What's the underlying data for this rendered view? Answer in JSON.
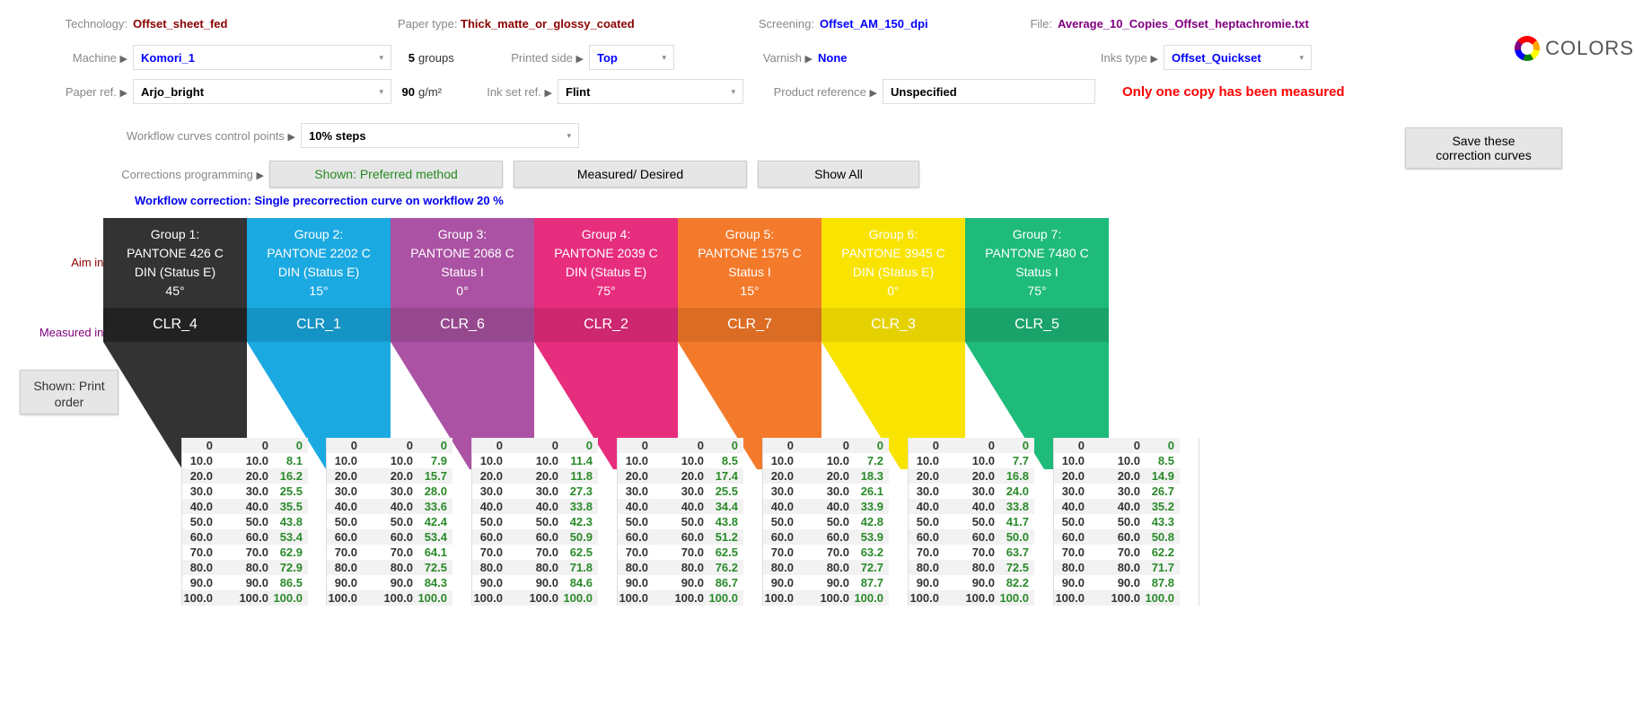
{
  "header": {
    "technology_label": "Technology:",
    "technology": "Offset_sheet_fed",
    "paper_type_label": "Paper type:",
    "paper_type": "Thick_matte_or_glossy_coated",
    "screening_label": "Screening:",
    "screening": "Offset_AM_150_dpi",
    "file_label": "File:",
    "file": "Average_10_Copies_Offset_heptachromie.txt",
    "machine_label": "Machine",
    "machine": "Komori_1",
    "groups_count": "5",
    "groups_unit": "groups",
    "printed_side_label": "Printed side",
    "printed_side": "Top",
    "varnish_label": "Varnish",
    "varnish": "None",
    "inks_type_label": "Inks type",
    "inks_type": "Offset_Quickset",
    "paper_ref_label": "Paper ref.",
    "paper_ref": "Arjo_bright",
    "gm": "90",
    "gm_unit": "g/m²",
    "ink_set_ref_label": "Ink set ref.",
    "ink_set_ref": "Flint",
    "product_ref_label": "Product reference",
    "product_ref": "Unspecified",
    "warning": "Only one copy has been measured",
    "workflow_label": "Workflow curves control points",
    "workflow_steps": "10% steps",
    "corrections_label": "Corrections programming",
    "btn_shown": "Shown: Preferred method",
    "btn_measured": "Measured/ Desired",
    "btn_showall": "Show All",
    "btn_save": "Save these correction curves",
    "logo_text": "COLORS"
  },
  "blue_line": "Workflow correction: Single precorrection curve on workflow 20 %",
  "side": {
    "aim": "Aim inks:",
    "measured": "Measured inks:"
  },
  "print_order": "Shown: Print order",
  "groups": [
    {
      "title": "Group 1:",
      "pantone": "PANTONE 426 C",
      "status": "DIN (Status E)",
      "angle": "45°",
      "clr": "CLR_4",
      "color": "#333333",
      "darker": "#222222"
    },
    {
      "title": "Group 2:",
      "pantone": "PANTONE 2202 C",
      "status": "DIN (Status E)",
      "angle": "15°",
      "clr": "CLR_1",
      "color": "#1BA9E1",
      "darker": "#1593C5"
    },
    {
      "title": "Group 3:",
      "pantone": "PANTONE 2068 C",
      "status": "Status I",
      "angle": "0°",
      "clr": "CLR_6",
      "color": "#AB52A4",
      "darker": "#96488F"
    },
    {
      "title": "Group 4:",
      "pantone": "PANTONE 2039 C",
      "status": "DIN (Status E)",
      "angle": "75°",
      "clr": "CLR_2",
      "color": "#E72D7E",
      "darker": "#CC276F"
    },
    {
      "title": "Group 5:",
      "pantone": "PANTONE 1575 C",
      "status": "Status I",
      "angle": "15°",
      "clr": "CLR_7",
      "color": "#F47A2B",
      "darker": "#DB6C24"
    },
    {
      "title": "Group 6:",
      "pantone": "PANTONE 3945 C",
      "status": "DIN (Status E)",
      "angle": "0°",
      "clr": "CLR_3",
      "color": "#F9E300",
      "darker": "#E5D100"
    },
    {
      "title": "Group 7:",
      "pantone": "PANTONE 7480 C",
      "status": "Status I",
      "angle": "75°",
      "clr": "CLR_5",
      "color": "#1EBB7A",
      "darker": "#19A36A"
    }
  ],
  "steps": [
    "0",
    "10.0",
    "20.0",
    "30.0",
    "40.0",
    "50.0",
    "60.0",
    "70.0",
    "80.0",
    "90.0",
    "100.0"
  ],
  "tables": [
    [
      "0",
      "8.1",
      "16.2",
      "25.5",
      "35.5",
      "43.8",
      "53.4",
      "62.9",
      "72.9",
      "86.5",
      "100.0"
    ],
    [
      "0",
      "7.9",
      "15.7",
      "28.0",
      "33.6",
      "42.4",
      "53.4",
      "64.1",
      "72.5",
      "84.3",
      "100.0"
    ],
    [
      "0",
      "11.4",
      "11.8",
      "27.3",
      "33.8",
      "42.3",
      "50.9",
      "62.5",
      "71.8",
      "84.6",
      "100.0"
    ],
    [
      "0",
      "8.5",
      "17.4",
      "25.5",
      "34.4",
      "43.8",
      "51.2",
      "62.5",
      "76.2",
      "86.7",
      "100.0"
    ],
    [
      "0",
      "7.2",
      "18.3",
      "26.1",
      "33.9",
      "42.8",
      "53.9",
      "63.2",
      "72.7",
      "87.7",
      "100.0"
    ],
    [
      "0",
      "7.7",
      "16.8",
      "24.0",
      "33.8",
      "41.7",
      "50.0",
      "63.7",
      "72.5",
      "82.2",
      "100.0"
    ],
    [
      "0",
      "8.5",
      "14.9",
      "26.7",
      "35.2",
      "43.3",
      "50.8",
      "62.2",
      "71.7",
      "87.8",
      "100.0"
    ]
  ]
}
